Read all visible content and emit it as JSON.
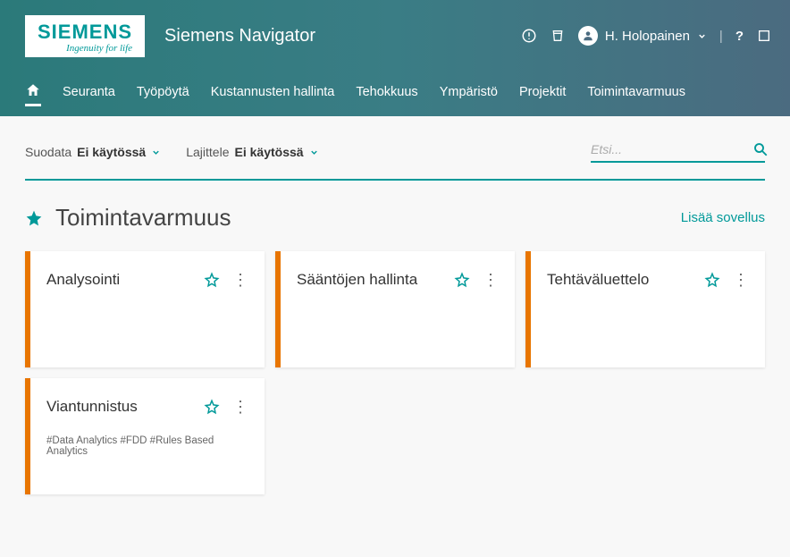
{
  "brand": {
    "name": "SIEMENS",
    "tagline": "Ingenuity for life"
  },
  "app_title": "Siemens Navigator",
  "user": {
    "display_name": "H. Holopainen"
  },
  "nav": {
    "items": [
      {
        "label": "Seuranta"
      },
      {
        "label": "Työpöytä"
      },
      {
        "label": "Kustannusten hallinta"
      },
      {
        "label": "Tehokkuus"
      },
      {
        "label": "Ympäristö"
      },
      {
        "label": "Projektit"
      },
      {
        "label": "Toimintavarmuus"
      }
    ]
  },
  "controls": {
    "filter_label": "Suodata",
    "filter_value": "Ei käytössä",
    "sort_label": "Lajittele",
    "sort_value": "Ei käytössä"
  },
  "search": {
    "placeholder": "Etsi..."
  },
  "section": {
    "title": "Toimintavarmuus",
    "add_app_label": "Lisää sovellus",
    "cards": [
      {
        "title": "Analysointi",
        "tags": ""
      },
      {
        "title": "Sääntöjen hallinta",
        "tags": ""
      },
      {
        "title": "Tehtäväluettelo",
        "tags": ""
      },
      {
        "title": "Viantunnistus",
        "tags": "#Data Analytics #FDD #Rules Based Analytics"
      }
    ]
  }
}
